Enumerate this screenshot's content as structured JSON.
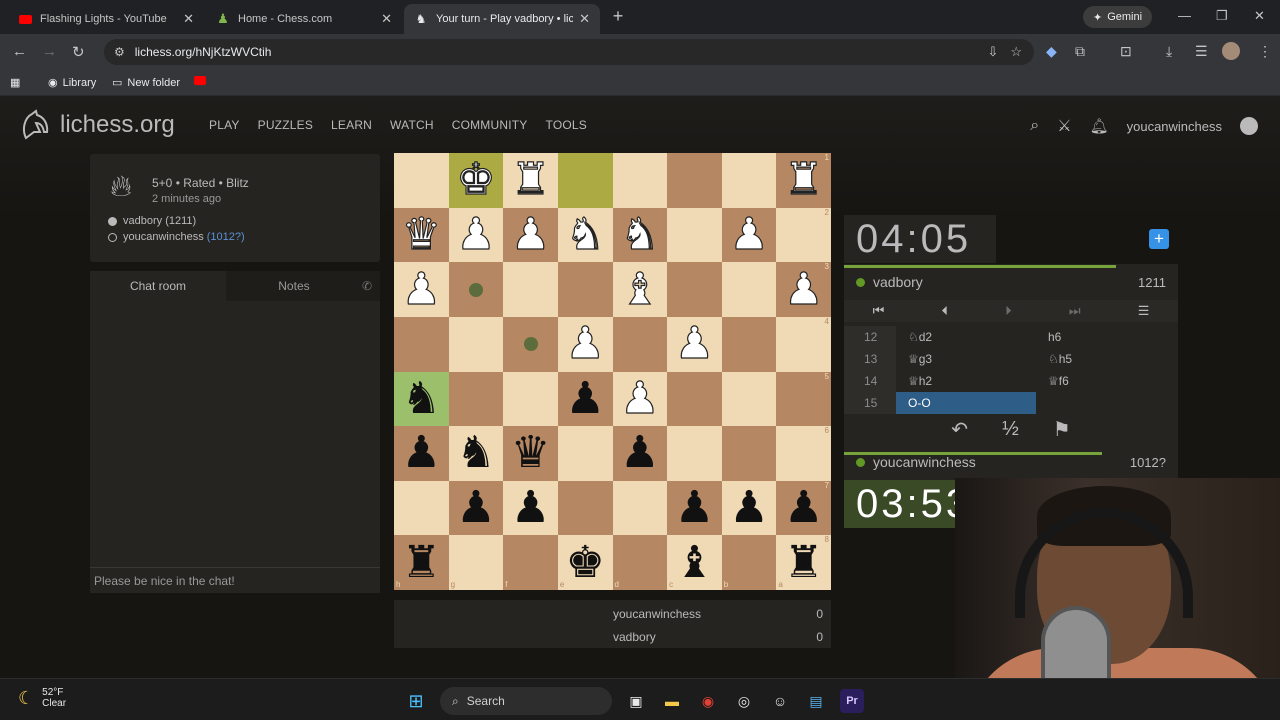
{
  "browser": {
    "tabs": [
      {
        "title": "Flashing Lights - YouTube"
      },
      {
        "title": "Home - Chess.com"
      },
      {
        "title": "Your turn - Play vadbory • lichess.org"
      }
    ],
    "gemini_label": "Gemini",
    "url": "lichess.org/hNjKtzWVCtih",
    "bookmarks": {
      "library": "Library",
      "new_folder": "New folder"
    }
  },
  "site": {
    "logo_text": "lichess.org",
    "nav": [
      "PLAY",
      "PUZZLES",
      "LEARN",
      "WATCH",
      "COMMUNITY",
      "TOOLS"
    ],
    "username": "youcanwinchess"
  },
  "game_info": {
    "setup": "5+0 • Rated • Blitz",
    "ago": "2 minutes ago",
    "white_player": "vadbory (1211)",
    "black_player_name": "youcanwinchess",
    "black_player_rating": "(1012?)"
  },
  "chat": {
    "tab_chat": "Chat room",
    "tab_notes": "Notes",
    "placeholder": "Please be nice in the chat!"
  },
  "board": {
    "orientation": "black",
    "ranks_right": [
      "1",
      "2",
      "3",
      "4",
      "5",
      "6",
      "7",
      "8"
    ],
    "files_bottom": [
      "h",
      "g",
      "f",
      "e",
      "d",
      "c",
      "b",
      "a"
    ],
    "squares": [
      [
        "",
        "wK",
        "wR",
        "",
        "",
        "",
        "",
        "wR"
      ],
      [
        "wQ",
        "wP",
        "wP",
        "wN",
        "wN",
        "",
        "wP",
        ""
      ],
      [
        "wP",
        "dot",
        "",
        "",
        "wB",
        "",
        "",
        "wP"
      ],
      [
        "",
        "",
        "dot",
        "wP",
        "",
        "wP",
        "",
        ""
      ],
      [
        "bN",
        "",
        "",
        "bP",
        "wP",
        "",
        "",
        ""
      ],
      [
        "bP",
        "bN",
        "bQ",
        "",
        "bP",
        "",
        "",
        ""
      ],
      [
        "",
        "bP",
        "bP",
        "",
        "",
        "bP",
        "bP",
        "bP"
      ],
      [
        "bR",
        "",
        "",
        "bK",
        "",
        "bB",
        "",
        "bR"
      ]
    ]
  },
  "scoreboard": [
    {
      "name": "youcanwinchess",
      "score": "0"
    },
    {
      "name": "vadbory",
      "score": "0"
    }
  ],
  "clocks": {
    "top": "04:05",
    "bottom": "03:53"
  },
  "players": {
    "top": {
      "name": "vadbory",
      "rating": "1211"
    },
    "bottom": {
      "name": "youcanwinchess",
      "rating": "1012?"
    }
  },
  "moves": [
    {
      "no": "12",
      "white": "♘d2",
      "black": "h6"
    },
    {
      "no": "13",
      "white": "♕g3",
      "black": "♘h5"
    },
    {
      "no": "14",
      "white": "♕h2",
      "black": "♕f6"
    },
    {
      "no": "15",
      "white": "O-O",
      "black": ""
    }
  ],
  "actions": {
    "draw_label": "½"
  },
  "weather": {
    "temp": "52°F",
    "cond": "Clear"
  },
  "taskbar": {
    "search": "Search"
  }
}
